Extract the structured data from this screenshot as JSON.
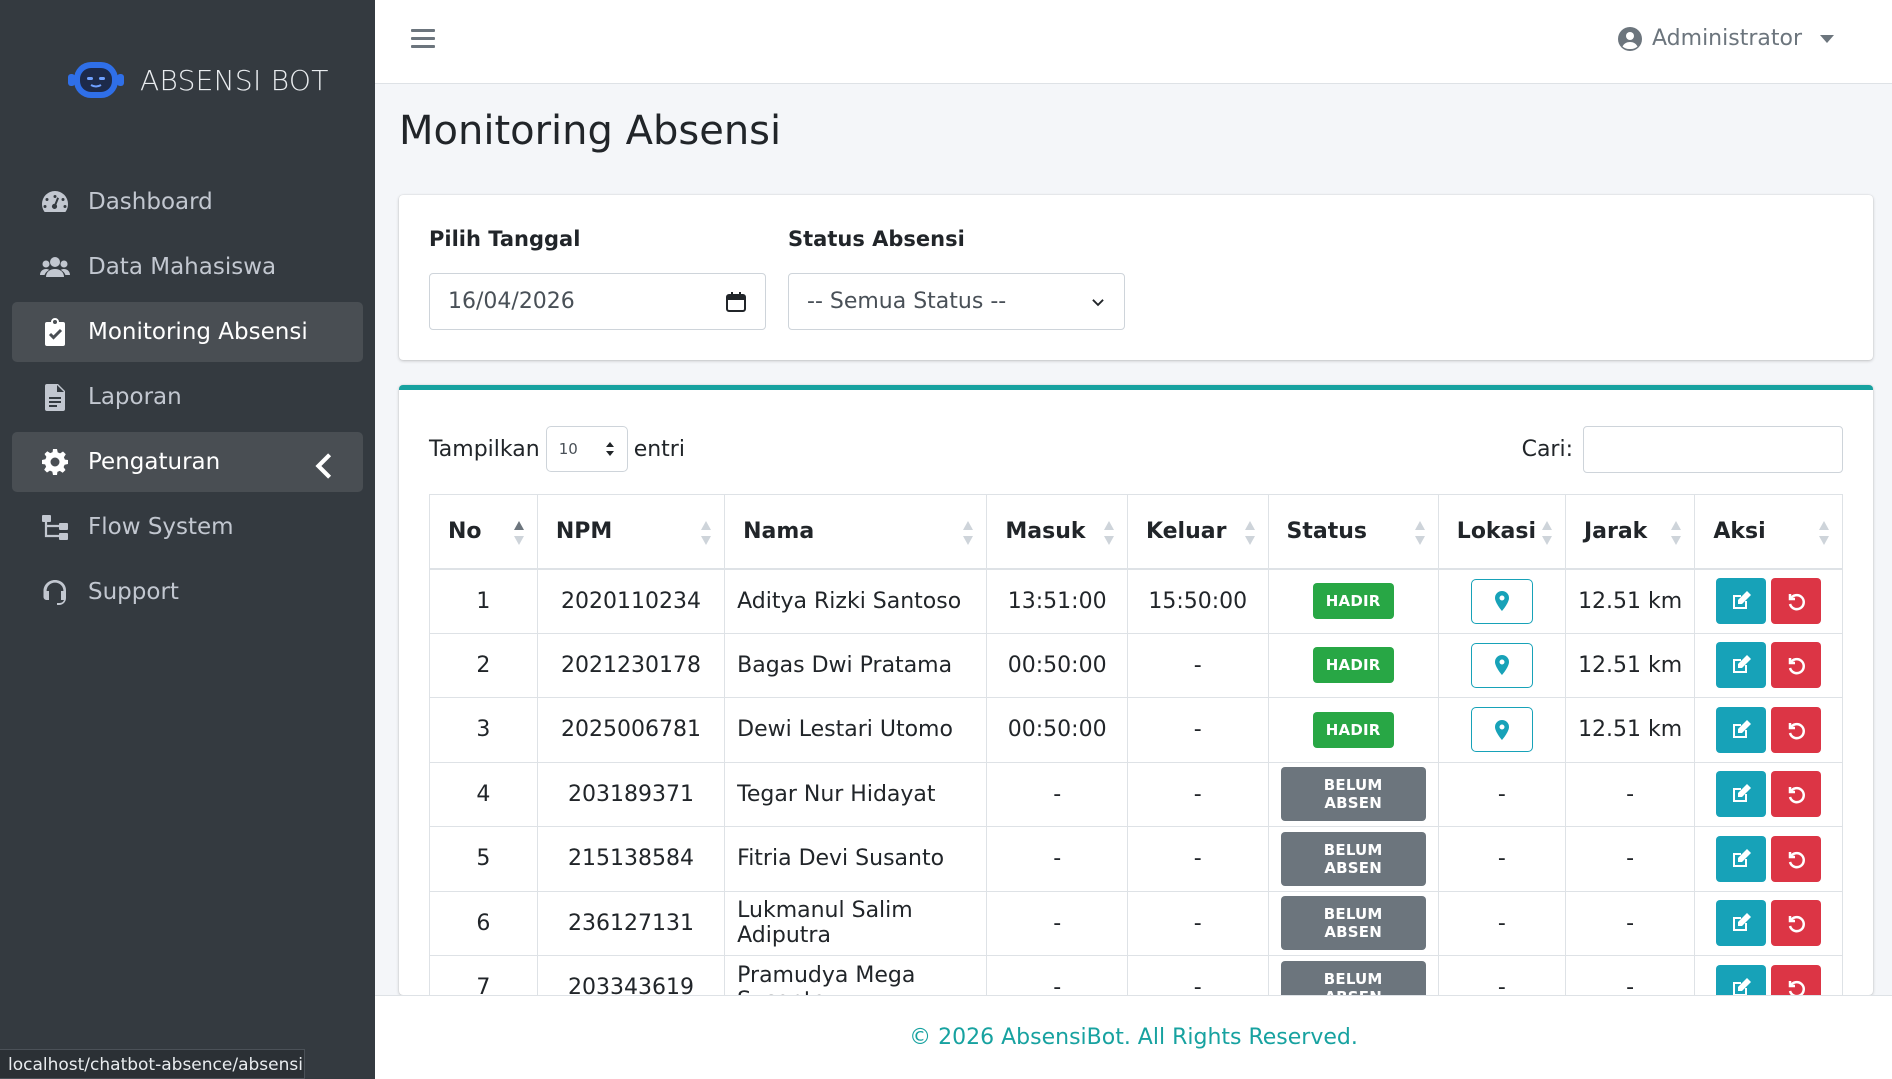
{
  "brand": {
    "name": "ABSENSI BOT"
  },
  "sidebar": {
    "items": [
      {
        "label": "Dashboard",
        "icon": "gauge-icon"
      },
      {
        "label": "Data Mahasiswa",
        "icon": "users-icon"
      },
      {
        "label": "Monitoring Absensi",
        "icon": "clipboard-check-icon"
      },
      {
        "label": "Laporan",
        "icon": "file-icon"
      },
      {
        "label": "Pengaturan",
        "icon": "gear-icon"
      },
      {
        "label": "Flow System",
        "icon": "sitemap-icon"
      },
      {
        "label": "Support",
        "icon": "headset-icon"
      }
    ]
  },
  "topbar": {
    "user": "Administrator"
  },
  "page": {
    "title": "Monitoring Absensi"
  },
  "filters": {
    "date_label": "Pilih Tanggal",
    "date_value": "16/04/2026",
    "status_label": "Status Absensi",
    "status_value": "-- Semua Status --"
  },
  "table_controls": {
    "show_label": "Tampilkan",
    "show_value": "10",
    "entries_label": "entri",
    "search_label": "Cari:"
  },
  "table": {
    "columns": [
      "No",
      "NPM",
      "Nama",
      "Masuk",
      "Keluar",
      "Status",
      "Lokasi",
      "Jarak",
      "Aksi"
    ],
    "rows": [
      {
        "no": "1",
        "npm": "2020110234",
        "nama": "Aditya Rizki Santoso",
        "masuk": "13:51:00",
        "keluar": "15:50:00",
        "status": "HADIR",
        "lokasi": true,
        "jarak": "12.51 km"
      },
      {
        "no": "2",
        "npm": "2021230178",
        "nama": "Bagas Dwi Pratama",
        "masuk": "00:50:00",
        "keluar": "-",
        "status": "HADIR",
        "lokasi": true,
        "jarak": "12.51 km"
      },
      {
        "no": "3",
        "npm": "2025006781",
        "nama": "Dewi Lestari Utomo",
        "masuk": "00:50:00",
        "keluar": "-",
        "status": "HADIR",
        "lokasi": true,
        "jarak": "12.51 km"
      },
      {
        "no": "4",
        "npm": "203189371",
        "nama": "Tegar Nur Hidayat",
        "masuk": "-",
        "keluar": "-",
        "status": "BELUM ABSEN",
        "lokasi": "-",
        "jarak": "-"
      },
      {
        "no": "5",
        "npm": "215138584",
        "nama": "Fitria Devi Susanto",
        "masuk": "-",
        "keluar": "-",
        "status": "BELUM ABSEN",
        "lokasi": "-",
        "jarak": "-"
      },
      {
        "no": "6",
        "npm": "236127131",
        "nama": "Lukmanul Salim Adiputra",
        "masuk": "-",
        "keluar": "-",
        "status": "BELUM ABSEN",
        "lokasi": "-",
        "jarak": "-"
      },
      {
        "no": "7",
        "npm": "203343619",
        "nama": "Pramudya Mega Susanto",
        "masuk": "-",
        "keluar": "-",
        "status": "BELUM ABSEN",
        "lokasi": "-",
        "jarak": "-"
      }
    ]
  },
  "footer": {
    "text": "© 2026 AbsensiBot. All Rights Reserved."
  },
  "statusbar": {
    "url": "localhost/chatbot-absence/absensi#"
  },
  "colors": {
    "accent": "#17a2a0",
    "hadir": "#28a745",
    "belum": "#6c757d",
    "edit": "#17a2b8",
    "reset": "#dc3545",
    "sidebar": "#343a40"
  }
}
